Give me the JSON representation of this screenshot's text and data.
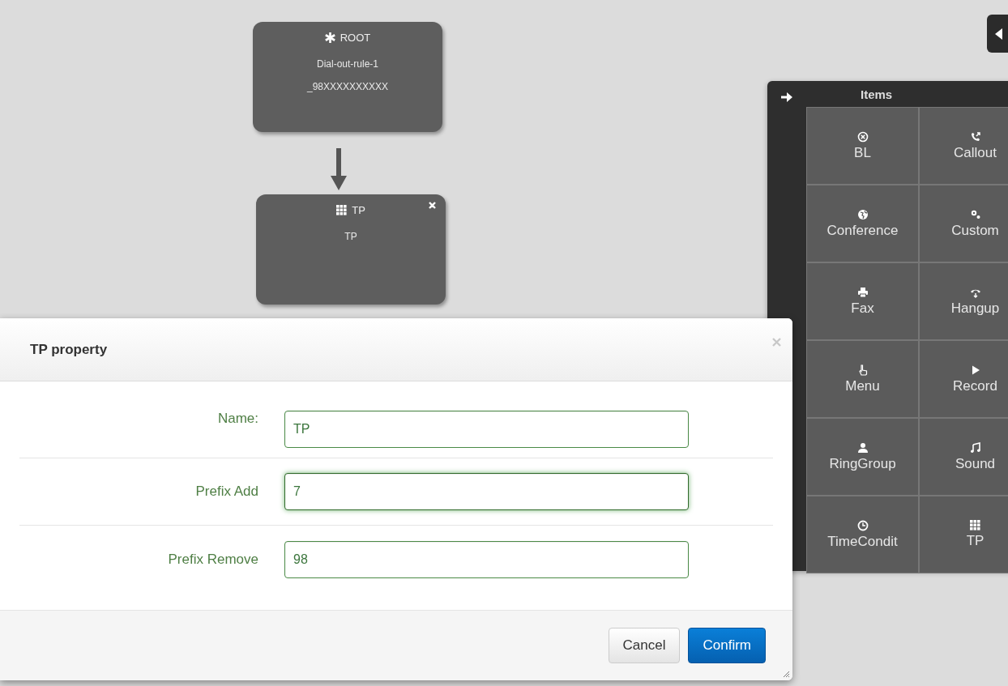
{
  "canvas": {
    "nodes": [
      {
        "kind": "root",
        "title": "ROOT",
        "lines": [
          "Dial-out-rule-1",
          "_98XXXXXXXXXX"
        ],
        "closable": false
      },
      {
        "kind": "tp",
        "title": "TP",
        "lines": [
          "TP"
        ],
        "closable": true
      }
    ]
  },
  "items_panel": {
    "title": "Items",
    "items": [
      {
        "kind": "bl",
        "label": "BL"
      },
      {
        "kind": "callout",
        "label": "Callout"
      },
      {
        "kind": "conference",
        "label": "Conference"
      },
      {
        "kind": "custom",
        "label": "Custom"
      },
      {
        "kind": "fax",
        "label": "Fax"
      },
      {
        "kind": "hangup",
        "label": "Hangup"
      },
      {
        "kind": "menu",
        "label": "Menu"
      },
      {
        "kind": "record",
        "label": "Record"
      },
      {
        "kind": "ringgroup",
        "label": "RingGroup"
      },
      {
        "kind": "sound",
        "label": "Sound"
      },
      {
        "kind": "timecondition",
        "label": "TimeCondit"
      },
      {
        "kind": "tp",
        "label": "TP"
      }
    ]
  },
  "dialog": {
    "title": "TP property",
    "fields": [
      {
        "label": "Name:",
        "value": "TP",
        "focused": false
      },
      {
        "label": "Prefix Add",
        "value": "7",
        "focused": true
      },
      {
        "label": "Prefix Remove",
        "value": "98",
        "focused": false
      }
    ],
    "buttons": [
      {
        "kind": "default",
        "label": "Cancel"
      },
      {
        "kind": "primary",
        "label": "Confirm"
      }
    ]
  }
}
